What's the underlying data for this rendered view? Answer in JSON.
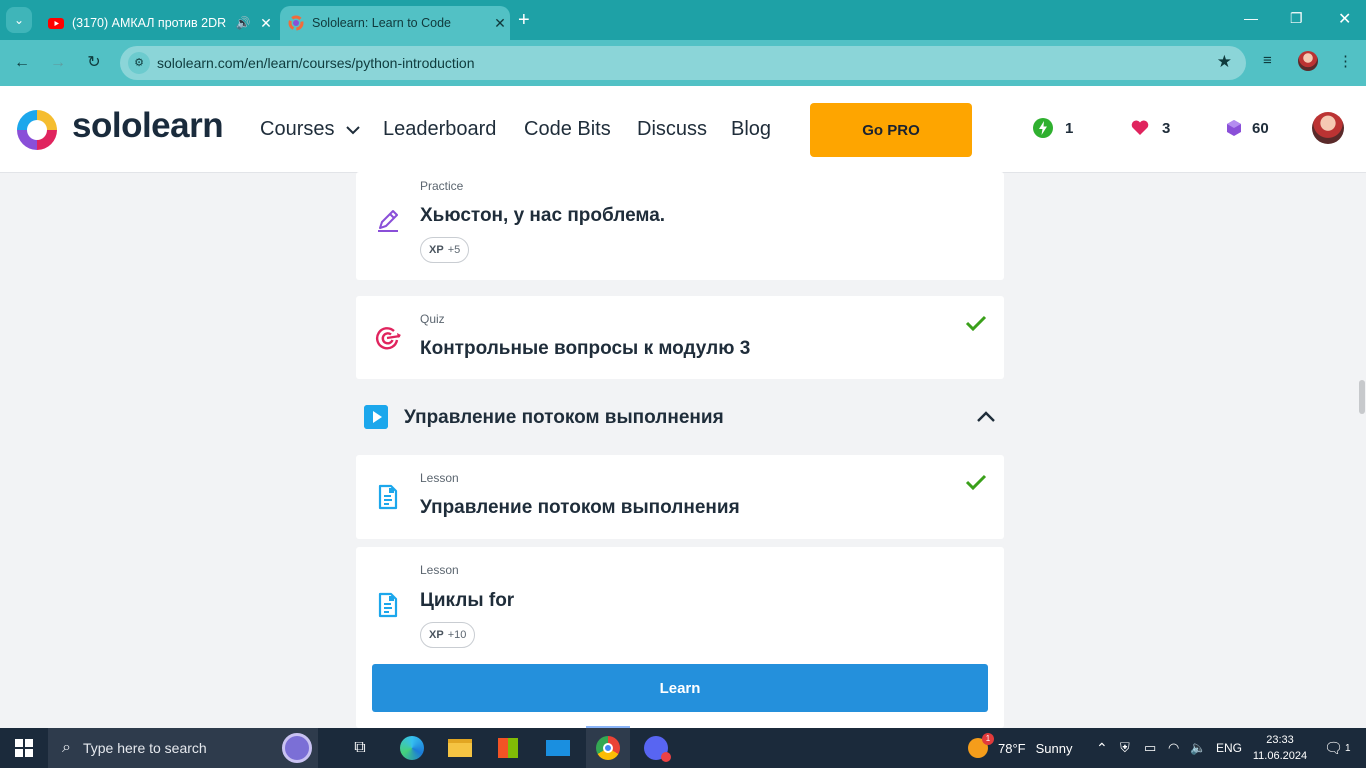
{
  "browser": {
    "tabs": [
      {
        "title": "(3170) АМКАЛ против 2DR",
        "icon": "youtube-icon",
        "audio": true
      },
      {
        "title": "Sololearn: Learn to Code",
        "icon": "sololearn-favicon",
        "active": true
      }
    ],
    "url": "sololearn.com/en/learn/courses/python-introduction"
  },
  "header": {
    "logo_text": "sololearn",
    "nav": [
      "Courses",
      "Leaderboard",
      "Code Bits",
      "Discuss",
      "Blog"
    ],
    "gopro_label": "Go PRO",
    "stats": {
      "streak": "1",
      "hearts": "3",
      "gems": "60"
    }
  },
  "content": {
    "practice": {
      "kind": "Practice",
      "title": "Хьюстон, у нас проблема.",
      "xp": "+5"
    },
    "quiz": {
      "kind": "Quiz",
      "title": "Контрольные вопросы к модулю 3",
      "completed": true
    },
    "module": {
      "title": "Управление потоком выполнения",
      "expanded": true
    },
    "lesson1": {
      "kind": "Lesson",
      "title": "Управление потоком выполнения",
      "completed": true
    },
    "lesson2": {
      "kind": "Lesson",
      "title": "Циклы for",
      "xp": "+10"
    },
    "xp_label": "XP",
    "learn_label": "Learn"
  },
  "taskbar": {
    "search_placeholder": "Type here to search",
    "weather": {
      "temp": "78°F",
      "condition": "Sunny",
      "badge": "1"
    },
    "language": "ENG",
    "time": "23:33",
    "date": "11.06.2024",
    "notifications": "1"
  },
  "colors": {
    "browser_frame": "#1ea1a6",
    "gopro": "#fea500",
    "learn_button": "#2490dc",
    "check": "#3aa01a",
    "practice_icon": "#8a4fd8",
    "quiz_icon": "#e0245e",
    "lesson_icon": "#1ca7ec"
  }
}
